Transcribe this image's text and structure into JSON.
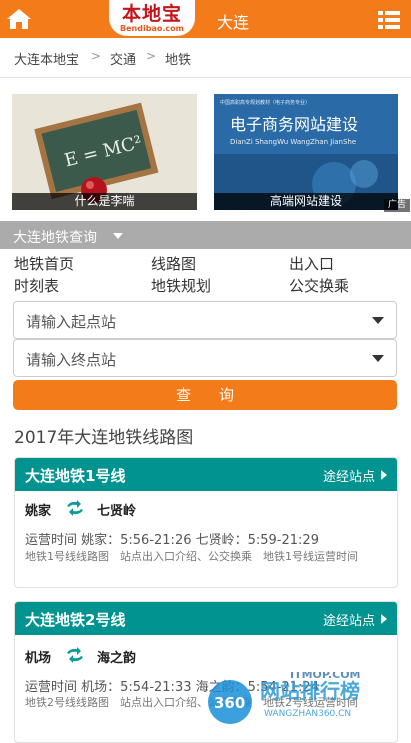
{
  "header": {
    "logo_main": "本地宝",
    "logo_sub": "Bendibao.com",
    "city": "大连",
    "brand_color": "#f47b1a"
  },
  "breadcrumb": {
    "items": [
      "大连本地宝",
      "交通",
      "地铁"
    ],
    "separator": ">"
  },
  "ads": [
    {
      "caption": "什么是李喘",
      "art_text": "E = MC²"
    },
    {
      "caption": "高端网站建设",
      "art_top": "中国高职高专规划教材（电子商务专业）",
      "art_title": "电子商务网站建设",
      "art_pinyin": "DianZi ShangWu WangZhan JianShe"
    }
  ],
  "ad_flag": "广告",
  "section": {
    "title": "大连地铁查询"
  },
  "nav_links": [
    "地铁首页",
    "线路图",
    "出入口",
    "时刻表",
    "地铁规划",
    "公交换乘"
  ],
  "query": {
    "start_placeholder": "请输入起点站",
    "end_placeholder": "请输入终点站",
    "button": "查询"
  },
  "map_title": "2017年大连地铁线路图",
  "lines": [
    {
      "name": "大连地铁1号线",
      "via_label": "途经站点",
      "from": "姚家",
      "to": "七贤岭",
      "hours": "运营时间 姚家：5:56-21:26 七贤岭：5:59-21:29",
      "links": "地铁1号线线路图　站点出入口介绍、公交换乘　地铁1号线运营时间"
    },
    {
      "name": "大连地铁2号线",
      "via_label": "途经站点",
      "from": "机场",
      "to": "海之韵",
      "hours": "运营时间 机场：5:54-21:33 海之韵：5:54-21:24",
      "links": "地铁2号线线路图　站点出入口介绍、公交换乘　地铁2号线运营时间"
    }
  ],
  "watermark": {
    "number": "360",
    "text": "网站排行榜",
    "url": "WANGZHAN360.CN",
    "tag": "ITMOP.COM"
  },
  "colors": {
    "teal": "#009390",
    "orange": "#f47b1a",
    "gray_bar": "#ababab"
  }
}
